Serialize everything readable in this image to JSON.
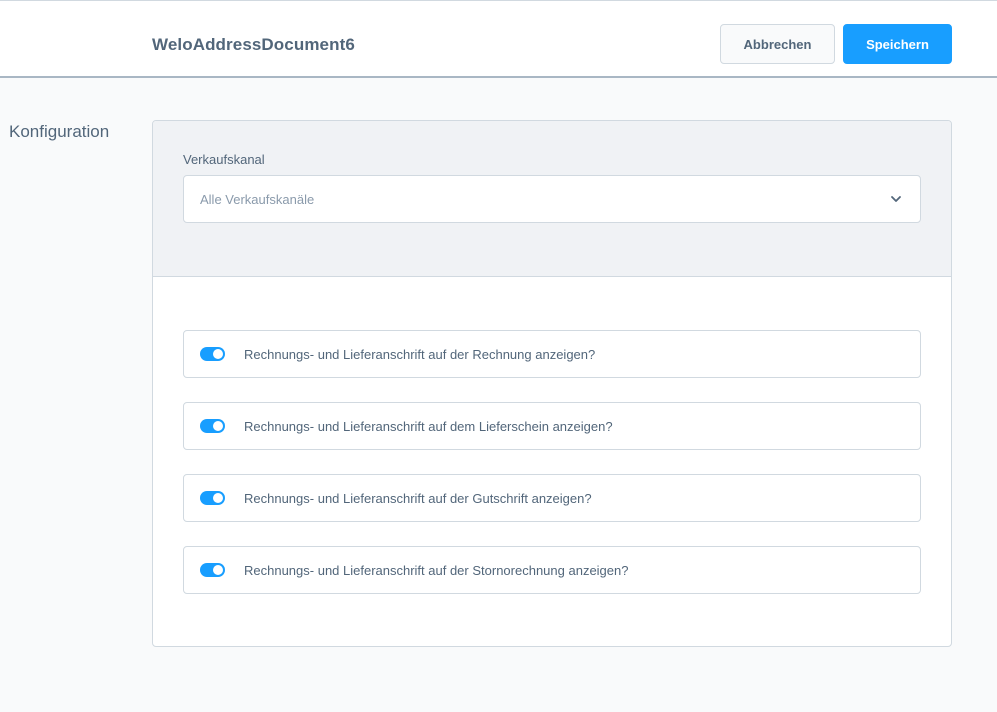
{
  "header": {
    "title": "WeloAddressDocument6",
    "cancel_label": "Abbrechen",
    "save_label": "Speichern"
  },
  "section": {
    "label": "Konfiguration"
  },
  "sales_channel": {
    "label": "Verkaufskanal",
    "value": "Alle Verkaufskanäle",
    "icon": "chevron-down-icon"
  },
  "switches": [
    {
      "label": "Rechnungs- und Lieferanschrift auf der Rechnung anzeigen?",
      "enabled": true
    },
    {
      "label": "Rechnungs- und Lieferanschrift auf dem Lieferschein anzeigen?",
      "enabled": true
    },
    {
      "label": "Rechnungs- und Lieferanschrift auf der Gutschrift anzeigen?",
      "enabled": true
    },
    {
      "label": "Rechnungs- und Lieferanschrift auf der Stornorechnung anzeigen?",
      "enabled": true
    }
  ],
  "colors": {
    "primary": "#189eff",
    "text": "#52667a",
    "placeholder": "#8a9aab",
    "border": "#d1d9e0",
    "background": "#f9fafb"
  }
}
